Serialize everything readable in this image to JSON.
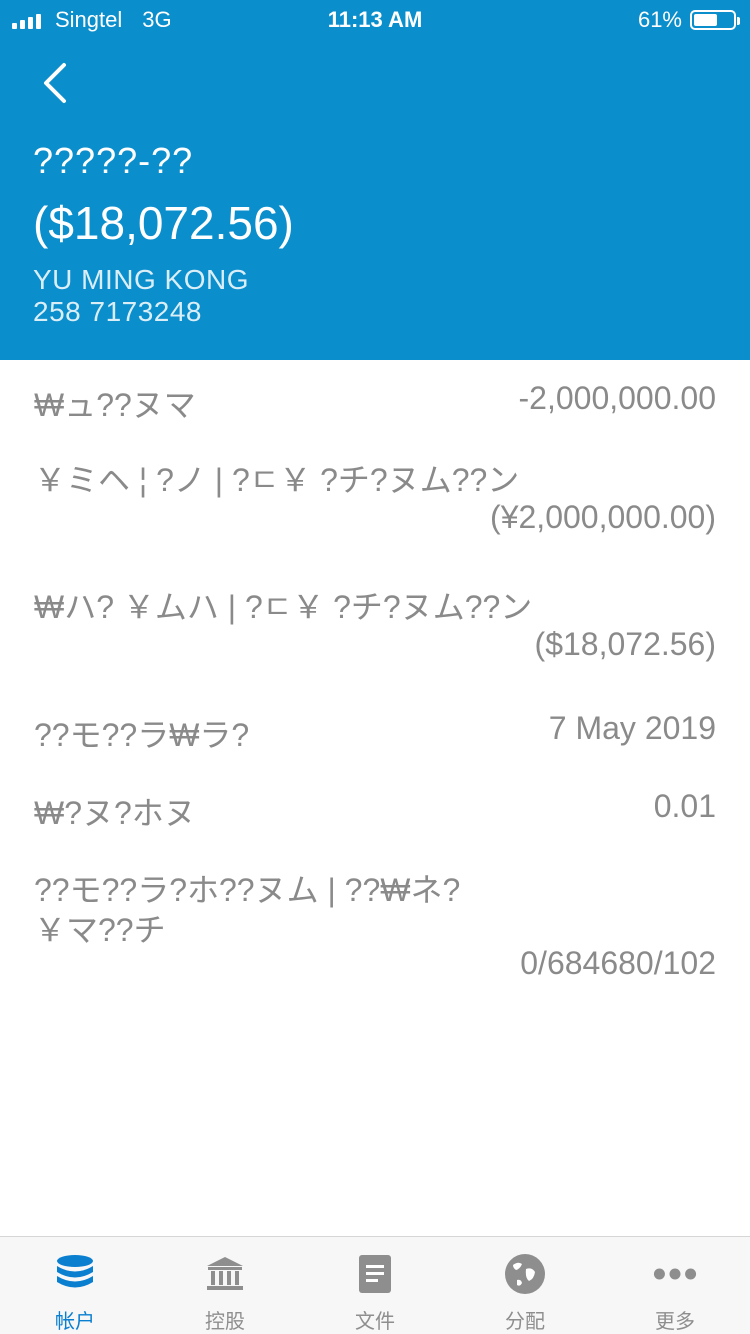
{
  "status_bar": {
    "carrier": "Singtel",
    "network": "3G",
    "time": "11:13 AM",
    "battery_percent": "61%",
    "battery_level": 0.61
  },
  "header": {
    "account_name": "?????-??",
    "balance": "($18,072.56)",
    "holder_name": "YU MING KONG",
    "account_number": "258 7173248"
  },
  "details": [
    {
      "label": "₩ュ??ヌマ",
      "value": "-2,000,000.00"
    },
    {
      "label": "￥ミヘ ¦ ?ノ | ?ㄷ￥ ?チ?ヌム??ン",
      "value": "(¥2,000,000.00)"
    },
    {
      "label": "₩ハ? ￥ムハ | ?ㄷ￥ ?チ?ヌム??ン",
      "value": "($18,072.56)"
    },
    {
      "label": "??モ??ラ₩ラ?",
      "value": "7 May 2019"
    },
    {
      "label": "₩?ヌ?ホヌ",
      "value": "0.01"
    },
    {
      "label": "??モ??ラ?ホ??ヌム | ??₩ネ?",
      "label2": "￥マ??チ",
      "value": "0/684680/102"
    }
  ],
  "tabs": [
    {
      "label": "帐户",
      "icon": "database-icon",
      "active": true
    },
    {
      "label": "控股",
      "icon": "bank-icon",
      "active": false
    },
    {
      "label": "文件",
      "icon": "document-icon",
      "active": false
    },
    {
      "label": "分配",
      "icon": "globe-icon",
      "active": false
    },
    {
      "label": "更多",
      "icon": "more-icon",
      "active": false
    }
  ],
  "colors": {
    "header_bg": "#0A8ECC",
    "active_tab": "#0A7FD0",
    "inactive_tab": "#8E8E8E",
    "detail_text": "#8A8A8A"
  }
}
